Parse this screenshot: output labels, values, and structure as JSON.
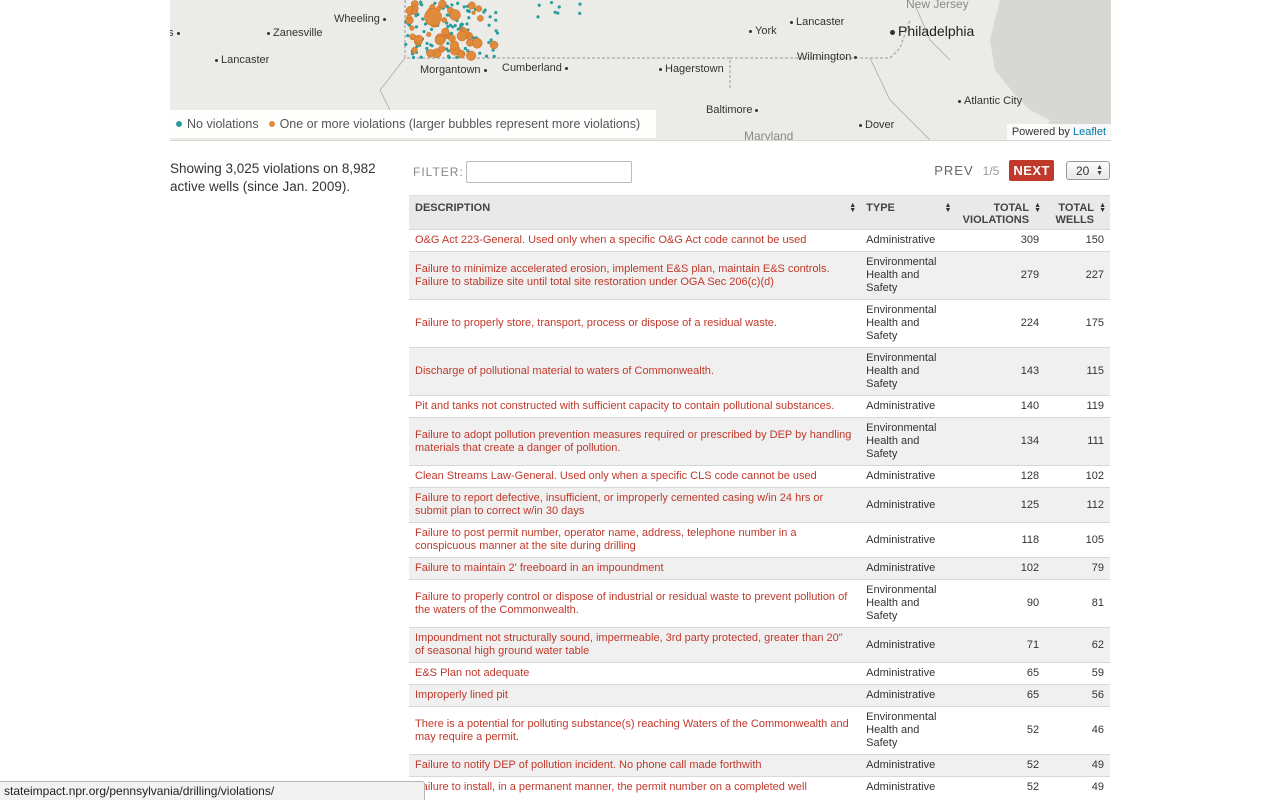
{
  "map": {
    "cities": [
      {
        "name": "New Jersey",
        "cls": "faint",
        "dot": false
      },
      {
        "name": "Wheeling",
        "cls": "",
        "dot": true
      },
      {
        "name": "Lancaster",
        "cls": "",
        "dot": true
      },
      {
        "name": "York",
        "cls": "",
        "dot": true
      },
      {
        "name": "Philadelphia",
        "cls": "big",
        "dot": true
      },
      {
        "name": "Zanesville",
        "cls": "",
        "dot": true
      },
      {
        "name": "Lancaster",
        "cls": "",
        "dot": true
      },
      {
        "name": "Wilmington",
        "cls": "",
        "dot": true
      },
      {
        "name": "Morgantown",
        "cls": "",
        "dot": true
      },
      {
        "name": "Cumberland",
        "cls": "",
        "dot": true
      },
      {
        "name": "Hagerstown",
        "cls": "",
        "dot": true
      },
      {
        "name": "Atlantic City",
        "cls": "",
        "dot": true
      },
      {
        "name": "Baltimore",
        "cls": "",
        "dot": true
      },
      {
        "name": "Dover",
        "cls": "",
        "dot": true
      },
      {
        "name": "Maryland",
        "cls": "faint",
        "dot": false
      }
    ],
    "legend": {
      "no_violations": "No violations",
      "violations": "One or more violations (larger bubbles represent more violations)"
    },
    "attribution_prefix": "Powered by",
    "attribution_link": "Leaflet",
    "colors": {
      "no_violations": "#2a9d9d",
      "violations": "#e08a3c"
    }
  },
  "summary": "Showing 3,025 violations on 8,982 active wells (since Jan. 2009).",
  "controls": {
    "filter_label": "FILTER:",
    "filter_value": "",
    "prev": "PREV",
    "pages": "1/5",
    "next": "NEXT",
    "per_page": "20"
  },
  "table": {
    "headers": {
      "description": "DESCRIPTION",
      "type": "TYPE",
      "total_violations_1": "TOTAL",
      "total_violations_2": "VIOLATIONS",
      "total_wells_1": "TOTAL",
      "total_wells_2": "WELLS"
    },
    "rows": [
      {
        "description": "O&G Act 223-General. Used only when a specific O&G Act code cannot be used",
        "type": "Administrative",
        "violations": "309",
        "wells": "150"
      },
      {
        "description": "Failure to minimize accelerated erosion, implement E&S plan, maintain E&S controls. Failure to stabilize site until total site restoration under OGA Sec 206(c)(d)",
        "type": "Environmental Health and Safety",
        "violations": "279",
        "wells": "227"
      },
      {
        "description": "Failure to properly store, transport, process or dispose of a residual waste.",
        "type": "Environmental Health and Safety",
        "violations": "224",
        "wells": "175"
      },
      {
        "description": "Discharge of pollutional material to waters of Commonwealth.",
        "type": "Environmental Health and Safety",
        "violations": "143",
        "wells": "115"
      },
      {
        "description": "Pit and tanks not constructed with sufficient capacity to contain pollutional substances.",
        "type": "Administrative",
        "violations": "140",
        "wells": "119"
      },
      {
        "description": "Failure to adopt pollution prevention measures required or prescribed by DEP by handling materials that create a danger of pollution.",
        "type": "Environmental Health and Safety",
        "violations": "134",
        "wells": "111"
      },
      {
        "description": "Clean Streams Law-General. Used only when a specific CLS code cannot be used",
        "type": "Administrative",
        "violations": "128",
        "wells": "102"
      },
      {
        "description": "Failure to report defective, insufficient, or improperly cemented casing w/in 24 hrs or submit plan to correct w/in 30 days",
        "type": "Administrative",
        "violations": "125",
        "wells": "112"
      },
      {
        "description": "Failure to post permit number, operator name, address, telephone number in a conspicuous manner at the site during drilling",
        "type": "Administrative",
        "violations": "118",
        "wells": "105"
      },
      {
        "description": "Failure to maintain 2' freeboard in an impoundment",
        "type": "Administrative",
        "violations": "102",
        "wells": "79"
      },
      {
        "description": "Failure to properly control or dispose of industrial or residual waste to prevent pollution of the waters of the Commonwealth.",
        "type": "Environmental Health and Safety",
        "violations": "90",
        "wells": "81"
      },
      {
        "description": "Impoundment not structurally sound, impermeable, 3rd party protected, greater than 20\" of seasonal high ground water table",
        "type": "Administrative",
        "violations": "71",
        "wells": "62"
      },
      {
        "description": "E&S Plan not adequate",
        "type": "Administrative",
        "violations": "65",
        "wells": "59"
      },
      {
        "description": "Improperly lined pit",
        "type": "Administrative",
        "violations": "65",
        "wells": "56"
      },
      {
        "description": "There is a potential for polluting substance(s) reaching Waters of the Commonwealth and may require a permit.",
        "type": "Environmental Health and Safety",
        "violations": "52",
        "wells": "46"
      },
      {
        "description": "Failure to notify DEP of pollution incident. No phone call made forthwith",
        "type": "Administrative",
        "violations": "52",
        "wells": "49"
      },
      {
        "description": "Failure to install, in a permanent manner, the permit number on a completed well",
        "type": "Administrative",
        "violations": "52",
        "wells": "49"
      }
    ]
  },
  "statusbar": "stateimpact.npr.org/pennsylvania/drilling/violations/"
}
